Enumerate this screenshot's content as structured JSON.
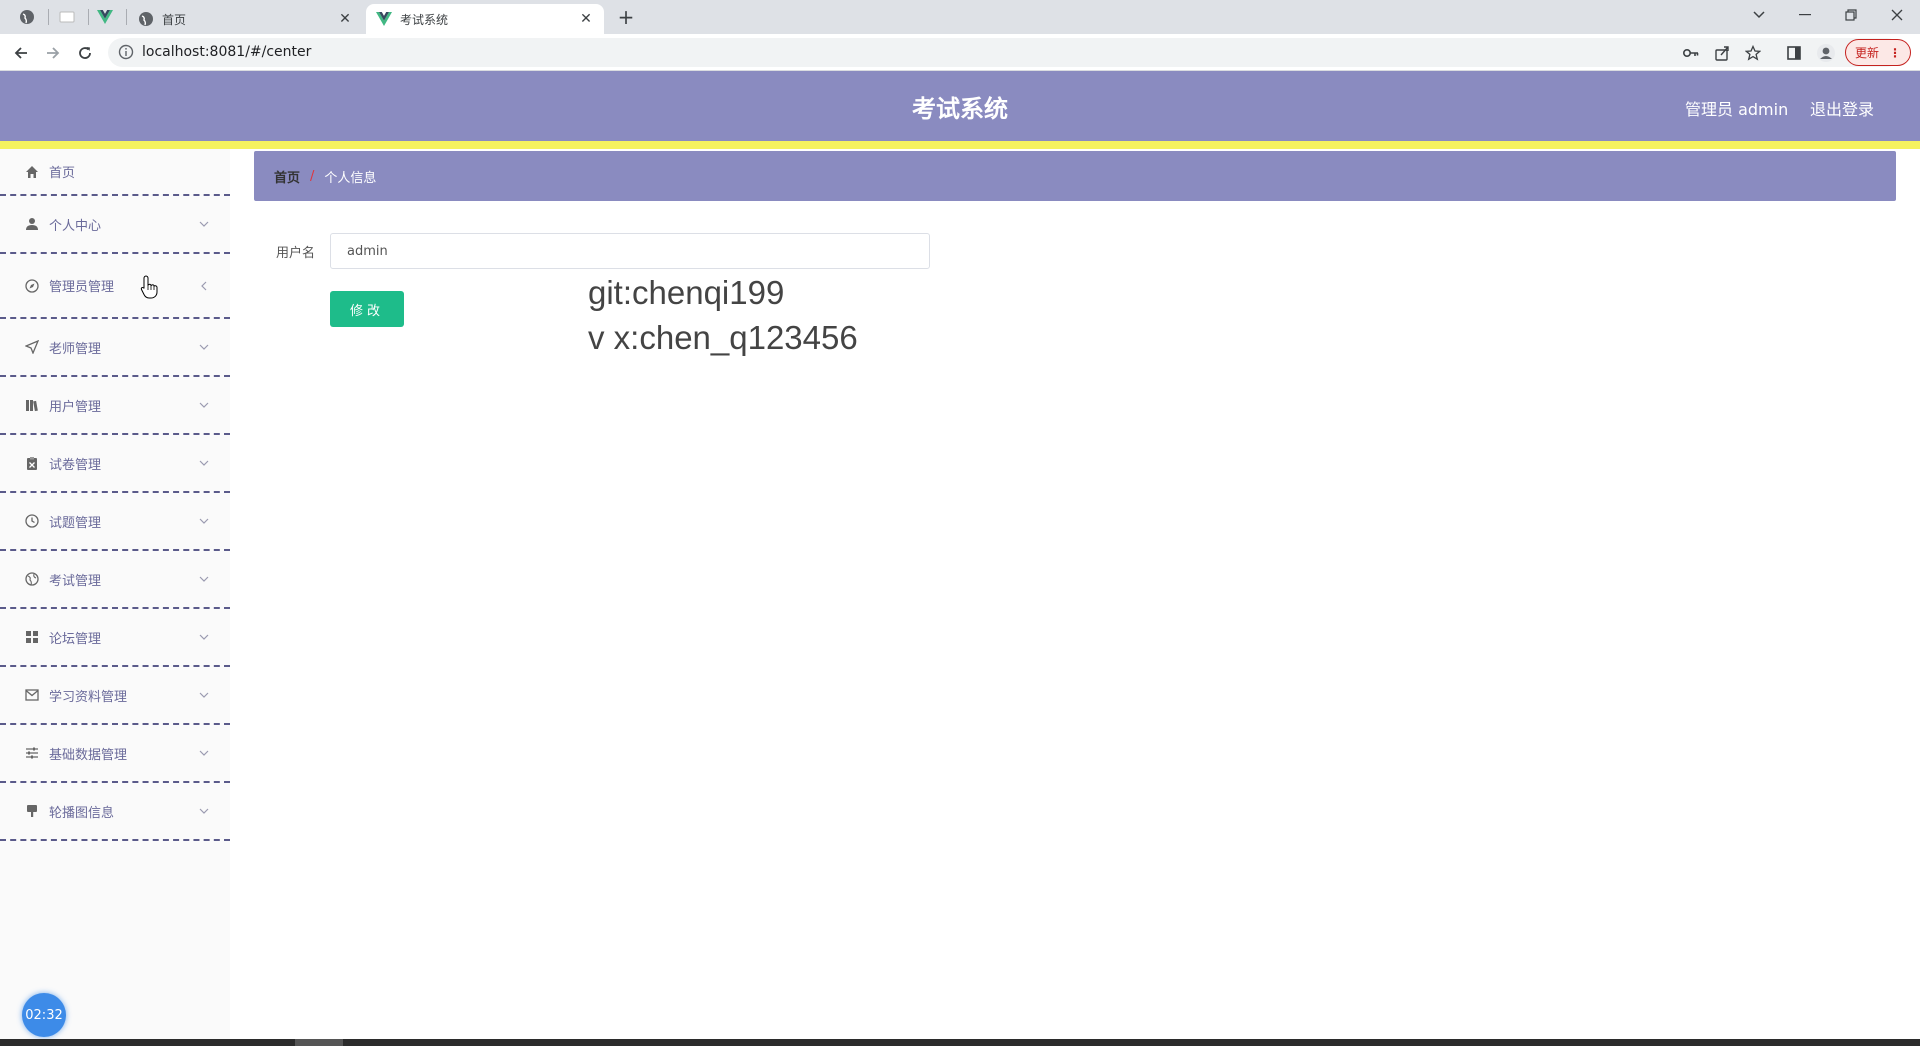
{
  "browser": {
    "tabs": [
      {
        "title": "首页",
        "icon": "globe-icon",
        "active": false
      },
      {
        "title": "考试系统",
        "icon": "vue-logo-icon",
        "active": true
      }
    ],
    "url": "localhost:8081/#/center",
    "update_label": "更新"
  },
  "header": {
    "title": "考试系统",
    "user": "管理员 admin",
    "logout": "退出登录",
    "bg_color": "#8a8bc0",
    "accent_color": "#f5f25f"
  },
  "sidebar": {
    "items": [
      {
        "label": "首页",
        "icon": "home-icon"
      },
      {
        "label": "个人中心",
        "icon": "user-icon"
      },
      {
        "label": "管理员管理",
        "icon": "compass-icon"
      },
      {
        "label": "老师管理",
        "icon": "send-icon"
      },
      {
        "label": "用户管理",
        "icon": "books-icon"
      },
      {
        "label": "试卷管理",
        "icon": "clipboard-icon"
      },
      {
        "label": "试题管理",
        "icon": "clock-icon"
      },
      {
        "label": "考试管理",
        "icon": "globe-icon"
      },
      {
        "label": "论坛管理",
        "icon": "grid-icon"
      },
      {
        "label": "学习资料管理",
        "icon": "mail-icon"
      },
      {
        "label": "基础数据管理",
        "icon": "sliders-icon"
      },
      {
        "label": "轮播图信息",
        "icon": "brush-icon"
      }
    ]
  },
  "breadcrumb": {
    "home": "首页",
    "separator": "/",
    "current": "个人信息"
  },
  "form": {
    "username_label": "用户名",
    "username_value": "admin",
    "save_label": "修改",
    "save_color": "#1ebc8a"
  },
  "watermark": {
    "line1": "git:chenqi199",
    "line2": "v x:chen_q123456"
  },
  "clock": "02:32"
}
